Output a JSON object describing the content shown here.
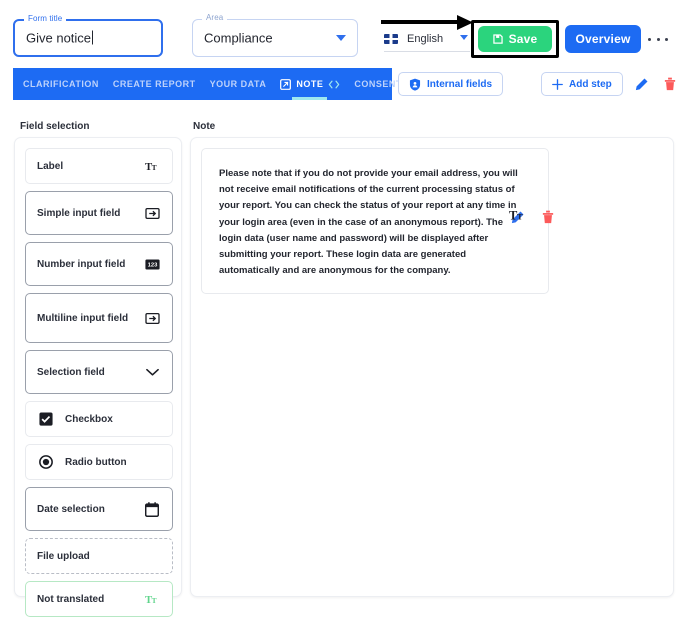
{
  "header": {
    "form_title": {
      "legend": "Form title",
      "value": "Give notice"
    },
    "area": {
      "legend": "Area",
      "value": "Compliance",
      "caret_icon": "chevron-down-icon"
    },
    "language": {
      "value": "English",
      "flag_icon": "uk-flag-icon",
      "caret_icon": "chevron-down-icon"
    },
    "save_button": {
      "label": "Save",
      "icon": "save-disk-icon",
      "color": "#2bd47d"
    },
    "overview_button": {
      "label": "Overview",
      "color": "#1d6bf3"
    },
    "more_menu": {
      "icon": "kebab-menu-icon"
    },
    "annotation": {
      "arrow_icon": "black-arrow-pointing-right",
      "highlight_target": "Save"
    }
  },
  "tabbar": {
    "background": "#1d6bf3",
    "active_underline_color": "#9fe8ef",
    "tabs": [
      {
        "label": "CLARIFICATION",
        "active": false
      },
      {
        "label": "CREATE REPORT",
        "active": false
      },
      {
        "label": "YOUR DATA",
        "active": false
      },
      {
        "label": "NOTE",
        "active": true,
        "leading_icon": "external-link-icon",
        "trailing_icon": "code-brackets-icon"
      },
      {
        "label": "CONSENT",
        "active": false
      }
    ],
    "internal_fields_button": {
      "label": "Internal fields",
      "icon": "shield-icon"
    },
    "add_step_button": {
      "label": "Add step",
      "icon": "plus-icon"
    },
    "edit_icon": "pencil-icon",
    "delete_icon": "trash-icon"
  },
  "left_panel": {
    "title": "Field selection",
    "fields": [
      {
        "label": "Label",
        "icon": "text-format-icon",
        "style": "light",
        "height": "h44"
      },
      {
        "label": "Simple input field",
        "icon": "input-field-icon",
        "style": "strong",
        "height": "h52"
      },
      {
        "label": "Number input field",
        "icon": "number-123-icon",
        "style": "strong",
        "height": "h52"
      },
      {
        "label": "Multiline input field",
        "icon": "input-field-icon",
        "style": "strong",
        "height": "h58"
      },
      {
        "label": "Selection field",
        "icon": "chevron-down-icon",
        "style": "strong",
        "height": "h52"
      },
      {
        "label": "Checkbox",
        "icon": "checkbox-checked-icon",
        "style": "light",
        "height": "h44",
        "icon_leading": true
      },
      {
        "label": "Radio button",
        "icon": "radio-selected-icon",
        "style": "light",
        "height": "h44",
        "icon_leading": true
      },
      {
        "label": "Date selection",
        "icon": "calendar-icon",
        "style": "strong",
        "height": "h52"
      },
      {
        "label": "File upload",
        "icon": "",
        "style": "dashed",
        "height": "h44"
      },
      {
        "label": "Not translated",
        "icon": "text-format-icon-green",
        "style": "green",
        "height": "h44"
      }
    ]
  },
  "right_panel": {
    "title": "Note",
    "note_text": "Please note that if you do not provide your email address, you will not receive email notifications of the current processing status of your report. You can check the status of your report at any time in your login area (even in the case of an anonymous report). The login data (user name and password) will be displayed after submitting your report. These login data are generated automatically and are anonymous for the company.",
    "note_type_icon": "text-format-icon",
    "edit_icon": "pencil-icon",
    "delete_icon": "trash-icon"
  }
}
